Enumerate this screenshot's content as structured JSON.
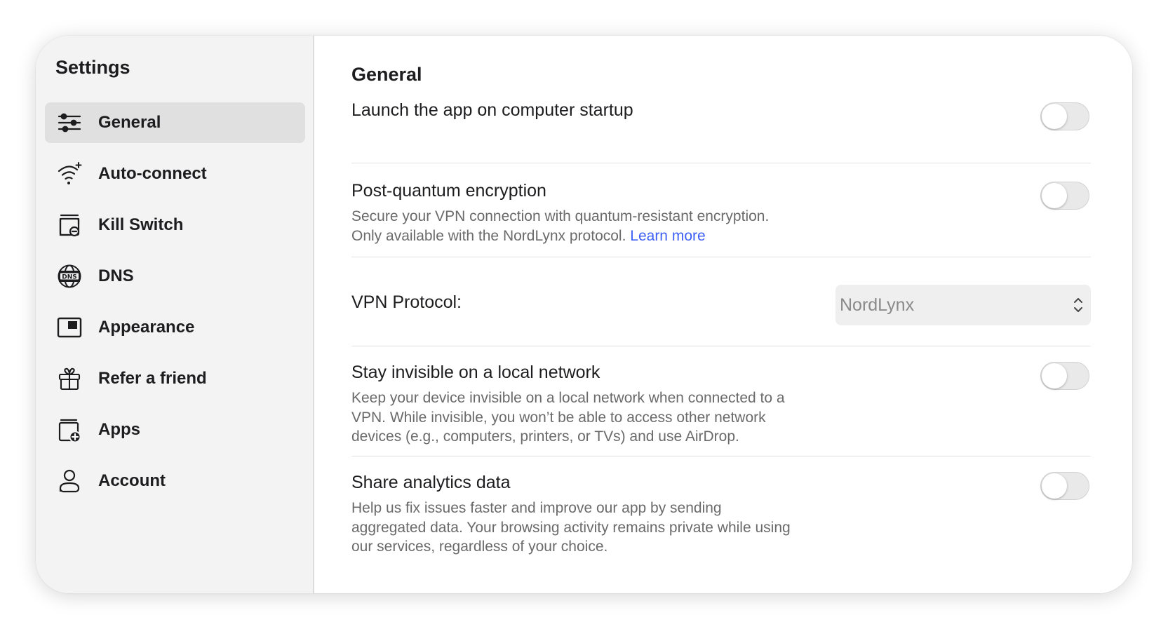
{
  "sidebar": {
    "title": "Settings",
    "items": [
      {
        "label": "General",
        "icon": "sliders-icon",
        "active": true
      },
      {
        "label": "Auto-connect",
        "icon": "wifi-sparkle-icon"
      },
      {
        "label": "Kill Switch",
        "icon": "kill-switch-icon"
      },
      {
        "label": "DNS",
        "icon": "dns-globe-icon"
      },
      {
        "label": "Appearance",
        "icon": "appearance-window-icon"
      },
      {
        "label": "Refer a friend",
        "icon": "gift-icon"
      },
      {
        "label": "Apps",
        "icon": "apps-add-icon"
      },
      {
        "label": "Account",
        "icon": "person-icon"
      }
    ]
  },
  "main": {
    "section_title": "General",
    "launch_startup": {
      "title": "Launch the app on computer startup",
      "enabled": false
    },
    "post_quantum": {
      "title": "Post-quantum encryption",
      "desc_line1": "Secure your VPN connection with quantum-resistant encryption.",
      "desc_line2": "Only available with the NordLynx protocol.",
      "link": "Learn more",
      "enabled": false
    },
    "vpn_protocol": {
      "label": "VPN Protocol:",
      "value": "NordLynx"
    },
    "invisible_lan": {
      "title": "Stay invisible on a local network",
      "desc_line1": "Keep your device invisible on a local network when connected to a",
      "desc_line2": "VPN. While invisible, you won’t be able to access other network",
      "desc_line3": "devices (e.g., computers, printers, or TVs) and use AirDrop.",
      "enabled": false
    },
    "analytics": {
      "title": "Share analytics data",
      "desc_line1": "Help us fix issues faster and improve our app by sending",
      "desc_line2": "aggregated data. Your browsing activity remains private while using",
      "desc_line3": "our services, regardless of your choice.",
      "enabled": false
    }
  },
  "colors": {
    "link": "#3e5ff5",
    "sidebar_bg": "#f3f3f3",
    "active_item_bg": "#e0e0e0"
  }
}
